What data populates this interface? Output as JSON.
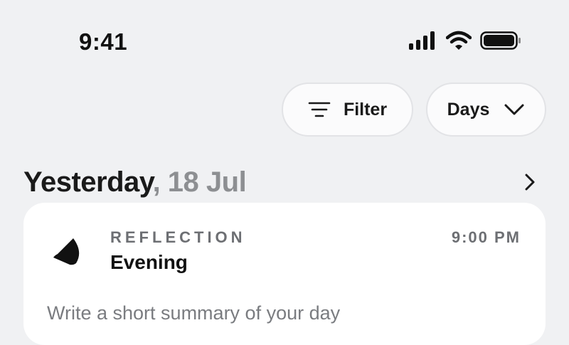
{
  "status_bar": {
    "time": "9:41",
    "icons": [
      "cellular-signal-icon",
      "wifi-icon",
      "battery-icon"
    ]
  },
  "controls": {
    "filter_label": "Filter",
    "filter_icon": "filter-lines-icon",
    "days_label": "Days",
    "days_icon": "chevron-down-icon"
  },
  "date_header": {
    "day_label": "Yesterday",
    "separator": ", ",
    "date": "18 Jul",
    "nav_icon": "chevron-right-icon"
  },
  "entry_card": {
    "icon": "half-moon-icon",
    "category": "REFLECTION",
    "title": "Evening",
    "time": "9:00 PM",
    "prompt": "Write a short summary of your day"
  },
  "colors": {
    "background": "#f0f1f3",
    "card": "#ffffff",
    "muted_text": "#8d8f92",
    "label_text": "#6d6f73"
  }
}
